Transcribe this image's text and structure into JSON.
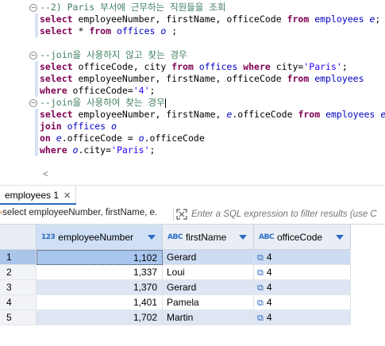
{
  "editor": {
    "lines": [
      {
        "fold": "−",
        "stmt": false,
        "tokens": [
          {
            "c": "cm",
            "t": "--2) Paris 부서에 근무하는 직원들을 조회"
          }
        ]
      },
      {
        "fold": "",
        "stmt": true,
        "tokens": [
          {
            "c": "kw",
            "t": "select "
          },
          {
            "c": "op",
            "t": "employeeNumber, firstName, officeCode "
          },
          {
            "c": "kw",
            "t": "from "
          },
          {
            "c": "tb",
            "t": "employees "
          },
          {
            "c": "al",
            "t": "e"
          },
          {
            "c": "op",
            "t": ";"
          }
        ]
      },
      {
        "fold": "",
        "stmt": true,
        "tokens": [
          {
            "c": "kw",
            "t": "select "
          },
          {
            "c": "op",
            "t": "* "
          },
          {
            "c": "kw",
            "t": "from "
          },
          {
            "c": "tb",
            "t": "offices "
          },
          {
            "c": "al",
            "t": "o"
          },
          {
            "c": "op",
            "t": " ;"
          }
        ]
      },
      {
        "fold": "",
        "stmt": false,
        "tokens": []
      },
      {
        "fold": "−",
        "stmt": false,
        "tokens": [
          {
            "c": "cm",
            "t": "--join을 사용하지 않고 찾는 경우"
          }
        ]
      },
      {
        "fold": "",
        "stmt": true,
        "tokens": [
          {
            "c": "kw",
            "t": "select "
          },
          {
            "c": "op",
            "t": "officeCode, city "
          },
          {
            "c": "kw",
            "t": "from "
          },
          {
            "c": "tb",
            "t": "offices "
          },
          {
            "c": "kw",
            "t": "where "
          },
          {
            "c": "op",
            "t": "city="
          },
          {
            "c": "st",
            "t": "'Paris'"
          },
          {
            "c": "op",
            "t": ";"
          }
        ]
      },
      {
        "fold": "",
        "stmt": true,
        "tokens": [
          {
            "c": "kw",
            "t": "select "
          },
          {
            "c": "op",
            "t": "employeeNumber, firstName, officeCode "
          },
          {
            "c": "kw",
            "t": "from "
          },
          {
            "c": "tb",
            "t": "employees"
          }
        ]
      },
      {
        "fold": "",
        "stmt": true,
        "tokens": [
          {
            "c": "kw",
            "t": "where "
          },
          {
            "c": "op",
            "t": "officeCode="
          },
          {
            "c": "st",
            "t": "'4'"
          },
          {
            "c": "op",
            "t": ";"
          }
        ]
      },
      {
        "fold": "−",
        "stmt": false,
        "tokens": [
          {
            "c": "cm",
            "t": "--join을 사용하여 찾는 경우"
          },
          {
            "c": "caret",
            "t": ""
          }
        ]
      },
      {
        "fold": "",
        "stmt": true,
        "tokens": [
          {
            "c": "kw",
            "t": "select "
          },
          {
            "c": "op",
            "t": "employeeNumber, firstName, "
          },
          {
            "c": "al",
            "t": "e"
          },
          {
            "c": "op",
            "t": ".officeCode "
          },
          {
            "c": "kw",
            "t": "from "
          },
          {
            "c": "tb",
            "t": "employees "
          },
          {
            "c": "al",
            "t": "e"
          }
        ]
      },
      {
        "fold": "",
        "stmt": true,
        "tokens": [
          {
            "c": "kw",
            "t": "join "
          },
          {
            "c": "tb",
            "t": "offices "
          },
          {
            "c": "al",
            "t": "o"
          }
        ]
      },
      {
        "fold": "",
        "stmt": true,
        "tokens": [
          {
            "c": "kw",
            "t": "on "
          },
          {
            "c": "al",
            "t": "e"
          },
          {
            "c": "op",
            "t": ".officeCode = "
          },
          {
            "c": "al",
            "t": "o"
          },
          {
            "c": "op",
            "t": ".officeCode"
          }
        ]
      },
      {
        "fold": "",
        "stmt": true,
        "tokens": [
          {
            "c": "kw",
            "t": "where "
          },
          {
            "c": "al",
            "t": "o"
          },
          {
            "c": "op",
            "t": ".city="
          },
          {
            "c": "st",
            "t": "'Paris'"
          },
          {
            "c": "op",
            "t": ";"
          }
        ]
      }
    ],
    "scroll_left_glyph": "<"
  },
  "tab": {
    "label": "employees 1",
    "close_glyph": "✕"
  },
  "filter": {
    "query_text": "select employeeNumber, firstName, e.",
    "placeholder": "Enter a SQL expression to filter results (use C"
  },
  "grid": {
    "columns": [
      {
        "label": "employeeNumber",
        "type_icon": "123"
      },
      {
        "label": "firstName",
        "type_icon": "ABC"
      },
      {
        "label": "officeCode",
        "type_icon": "ABC"
      }
    ],
    "rows": [
      {
        "n": "1",
        "employeeNumber": "1,102",
        "firstName": "Gerard",
        "officeCode": "4"
      },
      {
        "n": "2",
        "employeeNumber": "1,337",
        "firstName": "Loui",
        "officeCode": "4"
      },
      {
        "n": "3",
        "employeeNumber": "1,370",
        "firstName": "Gerard",
        "officeCode": "4"
      },
      {
        "n": "4",
        "employeeNumber": "1,401",
        "firstName": "Pamela",
        "officeCode": "4"
      },
      {
        "n": "5",
        "employeeNumber": "1,702",
        "firstName": "Martin",
        "officeCode": "4"
      }
    ],
    "link_icon": "external-link-icon"
  }
}
